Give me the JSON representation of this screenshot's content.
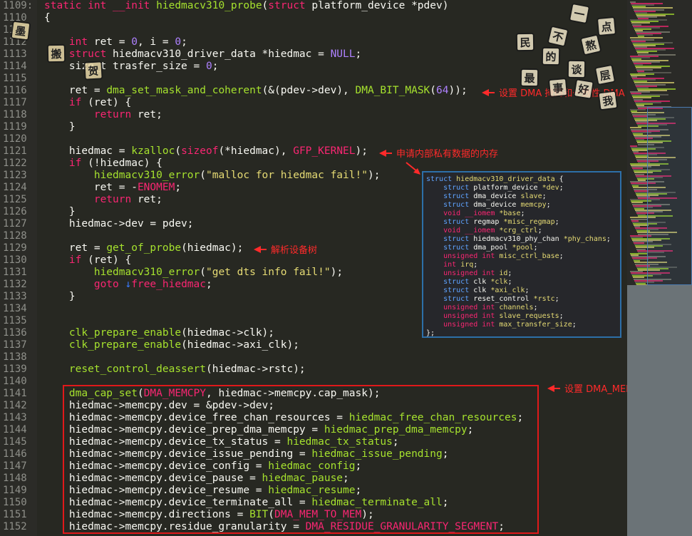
{
  "lines": [
    {
      "n": "1109:",
      "segs": [
        [
          "kw",
          "static int __init "
        ],
        [
          "fn",
          "hiedmacv310_probe"
        ],
        [
          "plain",
          "("
        ],
        [
          "kw",
          "struct "
        ],
        [
          "plain",
          "platform_device *pdev)"
        ]
      ]
    },
    {
      "n": "1110",
      "segs": [
        [
          "plain",
          "{"
        ]
      ]
    },
    {
      "n": "1111",
      "segs": []
    },
    {
      "n": "1112",
      "segs": [
        [
          "plain",
          "    "
        ],
        [
          "kw",
          "int "
        ],
        [
          "plain",
          "ret = "
        ],
        [
          "num",
          "0"
        ],
        [
          "plain",
          ", i = "
        ],
        [
          "num",
          "0"
        ],
        [
          "plain",
          ";"
        ]
      ]
    },
    {
      "n": "1113",
      "segs": [
        [
          "plain",
          "    "
        ],
        [
          "kw",
          "struct "
        ],
        [
          "plain",
          "hiedmacv310_driver_data *hiedmac = "
        ],
        [
          "num",
          "NULL"
        ],
        [
          "plain",
          ";"
        ]
      ]
    },
    {
      "n": "1114",
      "segs": [
        [
          "plain",
          "    size_t trasfer_size = "
        ],
        [
          "num",
          "0"
        ],
        [
          "plain",
          ";"
        ]
      ]
    },
    {
      "n": "1115",
      "segs": []
    },
    {
      "n": "1116",
      "segs": [
        [
          "plain",
          "    ret = "
        ],
        [
          "fn",
          "dma_set_mask_and_coherent"
        ],
        [
          "plain",
          "(&(pdev->dev), "
        ],
        [
          "fn",
          "DMA_BIT_MASK"
        ],
        [
          "plain",
          "("
        ],
        [
          "num",
          "64"
        ],
        [
          "plain",
          "));"
        ]
      ]
    },
    {
      "n": "1117",
      "segs": [
        [
          "plain",
          "    "
        ],
        [
          "kw",
          "if "
        ],
        [
          "plain",
          "(ret) {"
        ]
      ]
    },
    {
      "n": "1118",
      "segs": [
        [
          "plain",
          "        "
        ],
        [
          "kw",
          "return "
        ],
        [
          "plain",
          "ret;"
        ]
      ]
    },
    {
      "n": "1119",
      "segs": [
        [
          "plain",
          "    }"
        ]
      ]
    },
    {
      "n": "1120",
      "segs": []
    },
    {
      "n": "1121",
      "segs": [
        [
          "plain",
          "    hiedmac = "
        ],
        [
          "fn",
          "kzalloc"
        ],
        [
          "plain",
          "("
        ],
        [
          "kw",
          "sizeof"
        ],
        [
          "plain",
          "(*hiedmac), "
        ],
        [
          "mac",
          "GFP_KERNEL"
        ],
        [
          "plain",
          ");"
        ]
      ]
    },
    {
      "n": "1122",
      "segs": [
        [
          "plain",
          "    "
        ],
        [
          "kw",
          "if "
        ],
        [
          "plain",
          "(!hiedmac) {"
        ]
      ]
    },
    {
      "n": "1123",
      "segs": [
        [
          "plain",
          "        "
        ],
        [
          "fn",
          "hiedmacv310_error"
        ],
        [
          "plain",
          "("
        ],
        [
          "str",
          "\"malloc for hiedmac fail!\""
        ],
        [
          "plain",
          ");"
        ]
      ]
    },
    {
      "n": "1124",
      "segs": [
        [
          "plain",
          "        ret = -"
        ],
        [
          "mac",
          "ENOMEM"
        ],
        [
          "plain",
          ";"
        ]
      ]
    },
    {
      "n": "1125",
      "segs": [
        [
          "plain",
          "        "
        ],
        [
          "kw",
          "return "
        ],
        [
          "plain",
          "ret;"
        ]
      ]
    },
    {
      "n": "1126",
      "segs": [
        [
          "plain",
          "    }"
        ]
      ]
    },
    {
      "n": "1127",
      "segs": [
        [
          "plain",
          "    hiedmac->dev = pdev;"
        ]
      ]
    },
    {
      "n": "1128",
      "segs": []
    },
    {
      "n": "1129",
      "segs": [
        [
          "plain",
          "    ret = "
        ],
        [
          "fn",
          "get_of_probe"
        ],
        [
          "plain",
          "(hiedmac);"
        ]
      ]
    },
    {
      "n": "1130",
      "segs": [
        [
          "plain",
          "    "
        ],
        [
          "kw",
          "if "
        ],
        [
          "plain",
          "(ret) {"
        ]
      ]
    },
    {
      "n": "1131",
      "segs": [
        [
          "plain",
          "        "
        ],
        [
          "fn",
          "hiedmacv310_error"
        ],
        [
          "plain",
          "("
        ],
        [
          "str",
          "\"get dts info fail!\""
        ],
        [
          "plain",
          ");"
        ]
      ]
    },
    {
      "n": "1132",
      "segs": [
        [
          "plain",
          "        "
        ],
        [
          "kw",
          "goto "
        ],
        [
          "blue",
          "↓"
        ],
        [
          "mac",
          "free_hiedmac"
        ],
        [
          "plain",
          ";"
        ]
      ]
    },
    {
      "n": "1133",
      "segs": [
        [
          "plain",
          "    }"
        ]
      ]
    },
    {
      "n": "1134",
      "segs": []
    },
    {
      "n": "1135",
      "segs": []
    },
    {
      "n": "1136",
      "segs": [
        [
          "plain",
          "    "
        ],
        [
          "fn",
          "clk_prepare_enable"
        ],
        [
          "plain",
          "(hiedmac->clk);"
        ]
      ]
    },
    {
      "n": "1137",
      "segs": [
        [
          "plain",
          "    "
        ],
        [
          "fn",
          "clk_prepare_enable"
        ],
        [
          "plain",
          "(hiedmac->axi_clk);"
        ]
      ]
    },
    {
      "n": "1138",
      "segs": []
    },
    {
      "n": "1139",
      "segs": [
        [
          "plain",
          "    "
        ],
        [
          "fn",
          "reset_control_deassert"
        ],
        [
          "plain",
          "(hiedmac->rstc);"
        ]
      ]
    },
    {
      "n": "1140",
      "segs": []
    },
    {
      "n": "1141",
      "segs": [
        [
          "plain",
          "    "
        ],
        [
          "fn",
          "dma_cap_set"
        ],
        [
          "plain",
          "("
        ],
        [
          "mac",
          "DMA_MEMCPY"
        ],
        [
          "plain",
          ", hiedmac->memcpy.cap_mask);"
        ]
      ]
    },
    {
      "n": "1142",
      "segs": [
        [
          "plain",
          "    hiedmac->memcpy.dev = &pdev->dev;"
        ]
      ]
    },
    {
      "n": "1143",
      "segs": [
        [
          "plain",
          "    hiedmac->memcpy.device_free_chan_resources = "
        ],
        [
          "fn",
          "hiedmac_free_chan_resources"
        ],
        [
          "plain",
          ";"
        ]
      ]
    },
    {
      "n": "1144",
      "segs": [
        [
          "plain",
          "    hiedmac->memcpy.device_prep_dma_memcpy = "
        ],
        [
          "fn",
          "hiedmac_prep_dma_memcpy"
        ],
        [
          "plain",
          ";"
        ]
      ]
    },
    {
      "n": "1145",
      "segs": [
        [
          "plain",
          "    hiedmac->memcpy.device_tx_status = "
        ],
        [
          "fn",
          "hiedmac_tx_status"
        ],
        [
          "plain",
          ";"
        ]
      ]
    },
    {
      "n": "1146",
      "segs": [
        [
          "plain",
          "    hiedmac->memcpy.device_issue_pending = "
        ],
        [
          "fn",
          "hiedmac_issue_pending"
        ],
        [
          "plain",
          ";"
        ]
      ]
    },
    {
      "n": "1147",
      "segs": [
        [
          "plain",
          "    hiedmac->memcpy.device_config = "
        ],
        [
          "fn",
          "hiedmac_config"
        ],
        [
          "plain",
          ";"
        ]
      ]
    },
    {
      "n": "1148",
      "segs": [
        [
          "plain",
          "    hiedmac->memcpy.device_pause = "
        ],
        [
          "fn",
          "hiedmac_pause"
        ],
        [
          "plain",
          ";"
        ]
      ]
    },
    {
      "n": "1149",
      "segs": [
        [
          "plain",
          "    hiedmac->memcpy.device_resume = "
        ],
        [
          "fn",
          "hiedmac_resume"
        ],
        [
          "plain",
          ";"
        ]
      ]
    },
    {
      "n": "1150",
      "segs": [
        [
          "plain",
          "    hiedmac->memcpy.device_terminate_all = "
        ],
        [
          "fn",
          "hiedmac_terminate_all"
        ],
        [
          "plain",
          ";"
        ]
      ]
    },
    {
      "n": "1151",
      "segs": [
        [
          "plain",
          "    hiedmac->memcpy.directions = "
        ],
        [
          "fn",
          "BIT"
        ],
        [
          "plain",
          "("
        ],
        [
          "mac",
          "DMA_MEM_TO_MEM"
        ],
        [
          "plain",
          ");"
        ]
      ]
    },
    {
      "n": "1152",
      "segs": [
        [
          "plain",
          "    hiedmac->memcpy.residue_granularity = "
        ],
        [
          "mac",
          "DMA_RESIDUE_GRANULARITY_SEGMENT"
        ],
        [
          "plain",
          ";"
        ]
      ]
    }
  ],
  "annotations": {
    "dma_mask": "设置 DMA 掩码和一致性 DMA 掩码",
    "alloc": "申请内部私有数据的内存",
    "parse_dt": "解析设备树",
    "memcpy_cap": "设置 DMA_MEMCPY 能力集"
  },
  "struct_popup": [
    [
      [
        "kw",
        "struct "
      ],
      [
        "fld",
        "hiedmacv310_driver_data"
      ],
      [
        "plain",
        " {"
      ]
    ],
    [
      [
        "plain",
        "    "
      ],
      [
        "kw",
        "struct "
      ],
      [
        "plain",
        "platform_device "
      ],
      [
        "fld",
        "*dev"
      ],
      [
        "plain",
        ";"
      ]
    ],
    [
      [
        "plain",
        "    "
      ],
      [
        "kw",
        "struct "
      ],
      [
        "plain",
        "dma_device "
      ],
      [
        "fld",
        "slave"
      ],
      [
        "plain",
        ";"
      ]
    ],
    [
      [
        "plain",
        "    "
      ],
      [
        "kw",
        "struct "
      ],
      [
        "plain",
        "dma_device "
      ],
      [
        "fld",
        "memcpy"
      ],
      [
        "plain",
        ";"
      ]
    ],
    [
      [
        "plain",
        "    "
      ],
      [
        "red",
        "void __iomem "
      ],
      [
        "fld",
        "*base"
      ],
      [
        "plain",
        ";"
      ]
    ],
    [
      [
        "plain",
        "    "
      ],
      [
        "kw",
        "struct "
      ],
      [
        "plain",
        "regmap "
      ],
      [
        "fld",
        "*misc_regmap"
      ],
      [
        "plain",
        ";"
      ]
    ],
    [
      [
        "plain",
        "    "
      ],
      [
        "red",
        "void __iomem "
      ],
      [
        "fld",
        "*crg_ctrl"
      ],
      [
        "plain",
        ";"
      ]
    ],
    [
      [
        "plain",
        "    "
      ],
      [
        "kw",
        "struct "
      ],
      [
        "plain",
        "hiedmacv310_phy_chan "
      ],
      [
        "fld",
        "*phy_chans"
      ],
      [
        "plain",
        ";"
      ]
    ],
    [
      [
        "plain",
        "    "
      ],
      [
        "kw",
        "struct "
      ],
      [
        "plain",
        "dma_pool "
      ],
      [
        "fld",
        "*pool"
      ],
      [
        "plain",
        ";"
      ]
    ],
    [
      [
        "plain",
        "    "
      ],
      [
        "red",
        "unsigned int "
      ],
      [
        "fld",
        "misc_ctrl_base"
      ],
      [
        "plain",
        ";"
      ]
    ],
    [
      [
        "plain",
        "    "
      ],
      [
        "red",
        "int "
      ],
      [
        "fld",
        "irq"
      ],
      [
        "plain",
        ";"
      ]
    ],
    [
      [
        "plain",
        "    "
      ],
      [
        "red",
        "unsigned int "
      ],
      [
        "fld",
        "id"
      ],
      [
        "plain",
        ";"
      ]
    ],
    [
      [
        "plain",
        "    "
      ],
      [
        "kw",
        "struct "
      ],
      [
        "plain",
        "clk "
      ],
      [
        "fld",
        "*clk"
      ],
      [
        "plain",
        ";"
      ]
    ],
    [
      [
        "plain",
        "    "
      ],
      [
        "kw",
        "struct "
      ],
      [
        "plain",
        "clk "
      ],
      [
        "fld",
        "*axi_clk"
      ],
      [
        "plain",
        ";"
      ]
    ],
    [
      [
        "plain",
        "    "
      ],
      [
        "kw",
        "struct "
      ],
      [
        "plain",
        "reset_control "
      ],
      [
        "fld",
        "*rstc"
      ],
      [
        "plain",
        ";"
      ]
    ],
    [
      [
        "plain",
        "    "
      ],
      [
        "red",
        "unsigned int "
      ],
      [
        "fld",
        "channels"
      ],
      [
        "plain",
        ";"
      ]
    ],
    [
      [
        "plain",
        "    "
      ],
      [
        "red",
        "unsigned int "
      ],
      [
        "fld",
        "slave_requests"
      ],
      [
        "plain",
        ";"
      ]
    ],
    [
      [
        "plain",
        "    "
      ],
      [
        "red",
        "unsigned int "
      ],
      [
        "fld",
        "max_transfer_size"
      ],
      [
        "plain",
        ";"
      ]
    ],
    [
      [
        "plain",
        "};"
      ]
    ]
  ],
  "stickers_left": [
    "墨",
    "搬",
    "贺"
  ],
  "stickers_right": [
    "一",
    "点",
    "不",
    "熬",
    "民",
    "的",
    "谈",
    "层",
    "最",
    "好",
    "我",
    "事"
  ],
  "colors": {
    "background": "#272822",
    "keyword": "#f92672",
    "function": "#a6e22e",
    "string": "#e6db74",
    "number": "#ae81ff",
    "annotation": "#ff2a2a",
    "popup_border": "#2d6fa8"
  }
}
